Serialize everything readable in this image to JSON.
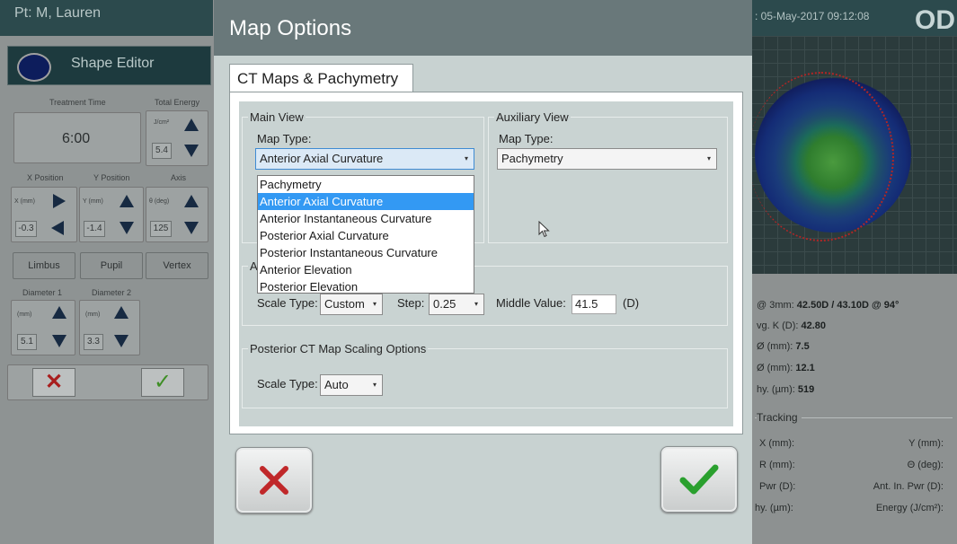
{
  "patient": {
    "label": "Pt:  M, Lauren"
  },
  "shape_editor": {
    "title": "Shape Editor"
  },
  "left_panel": {
    "treatment_time_label": "Treatment Time",
    "treatment_time": "6:00",
    "total_energy_label": "Total Energy",
    "energy_unit": "J/cm²",
    "energy_value": "5.4",
    "x_position_label": "X Position",
    "y_position_label": "Y Position",
    "axis_label": "Axis",
    "x_unit": "X (mm)",
    "y_unit": "Y (mm)",
    "axis_unit": "θ (deg)",
    "x_value": "-0.3",
    "y_value": "-1.4",
    "axis_value": "125",
    "limbus": "Limbus",
    "pupil": "Pupil",
    "vertex": "Vertex",
    "diameter1_label": "Diameter 1",
    "diameter2_label": "Diameter 2",
    "d1_unit": "(mm)",
    "d2_unit": "(mm)",
    "d1_value": "5.1",
    "d2_value": "3.3"
  },
  "right_panel": {
    "date": ": 05-May-2017 09:12:08",
    "eye": "OD",
    "k_label": "@ 3mm: ",
    "k_value": "42.50D / 43.10D @ 94°",
    "avg_k_label": "vg. K (D): ",
    "avg_k_value": "42.80",
    "pupil_d_label": "Ø (mm): ",
    "pupil_d_value": "7.5",
    "hvid_label": "Ø (mm): ",
    "hvid_value": "12.1",
    "pachy_label": "hy. (µm): ",
    "pachy_value": "519",
    "tracking_title": "Tracking",
    "tracking_left": [
      "X (mm):",
      "R (mm):",
      "Pwr (D):",
      "hy. (µm):"
    ],
    "tracking_right": [
      "Y (mm):",
      "Θ (deg):",
      "Ant. In. Pwr (D):",
      "Energy (J/cm²):"
    ]
  },
  "dialog": {
    "title": "Map Options",
    "tab": "CT Maps & Pachymetry",
    "main_view": {
      "legend": "Main View",
      "map_type_label": "Map Type:",
      "map_type_value": "Anterior Axial Curvature",
      "options": [
        "Pachymetry",
        "Anterior Axial Curvature",
        "Anterior Instantaneous Curvature",
        "Posterior Axial Curvature",
        "Posterior Instantaneous Curvature",
        "Anterior Elevation",
        "Posterior Elevation"
      ],
      "selected_index": 1
    },
    "aux_view": {
      "legend": "Auxiliary View",
      "map_type_label": "Map Type:",
      "map_type_value": "Pachymetry"
    },
    "anterior_scaling": {
      "legend_visible": "A",
      "scale_type_label": "Scale Type:",
      "scale_type_value": "Custom",
      "step_label": "Step:",
      "step_value": "0.25",
      "middle_value_label": "Middle Value:",
      "middle_value": "41.5",
      "middle_unit": "(D)"
    },
    "posterior_scaling": {
      "legend": "Posterior CT Map Scaling Options",
      "scale_type_label": "Scale Type:",
      "scale_type_value": "Auto"
    }
  },
  "colors": {
    "cancel": "#c0282a",
    "ok": "#2aa02e",
    "dropdown_selected": "#3399f3",
    "title_bar": "#69787a"
  }
}
